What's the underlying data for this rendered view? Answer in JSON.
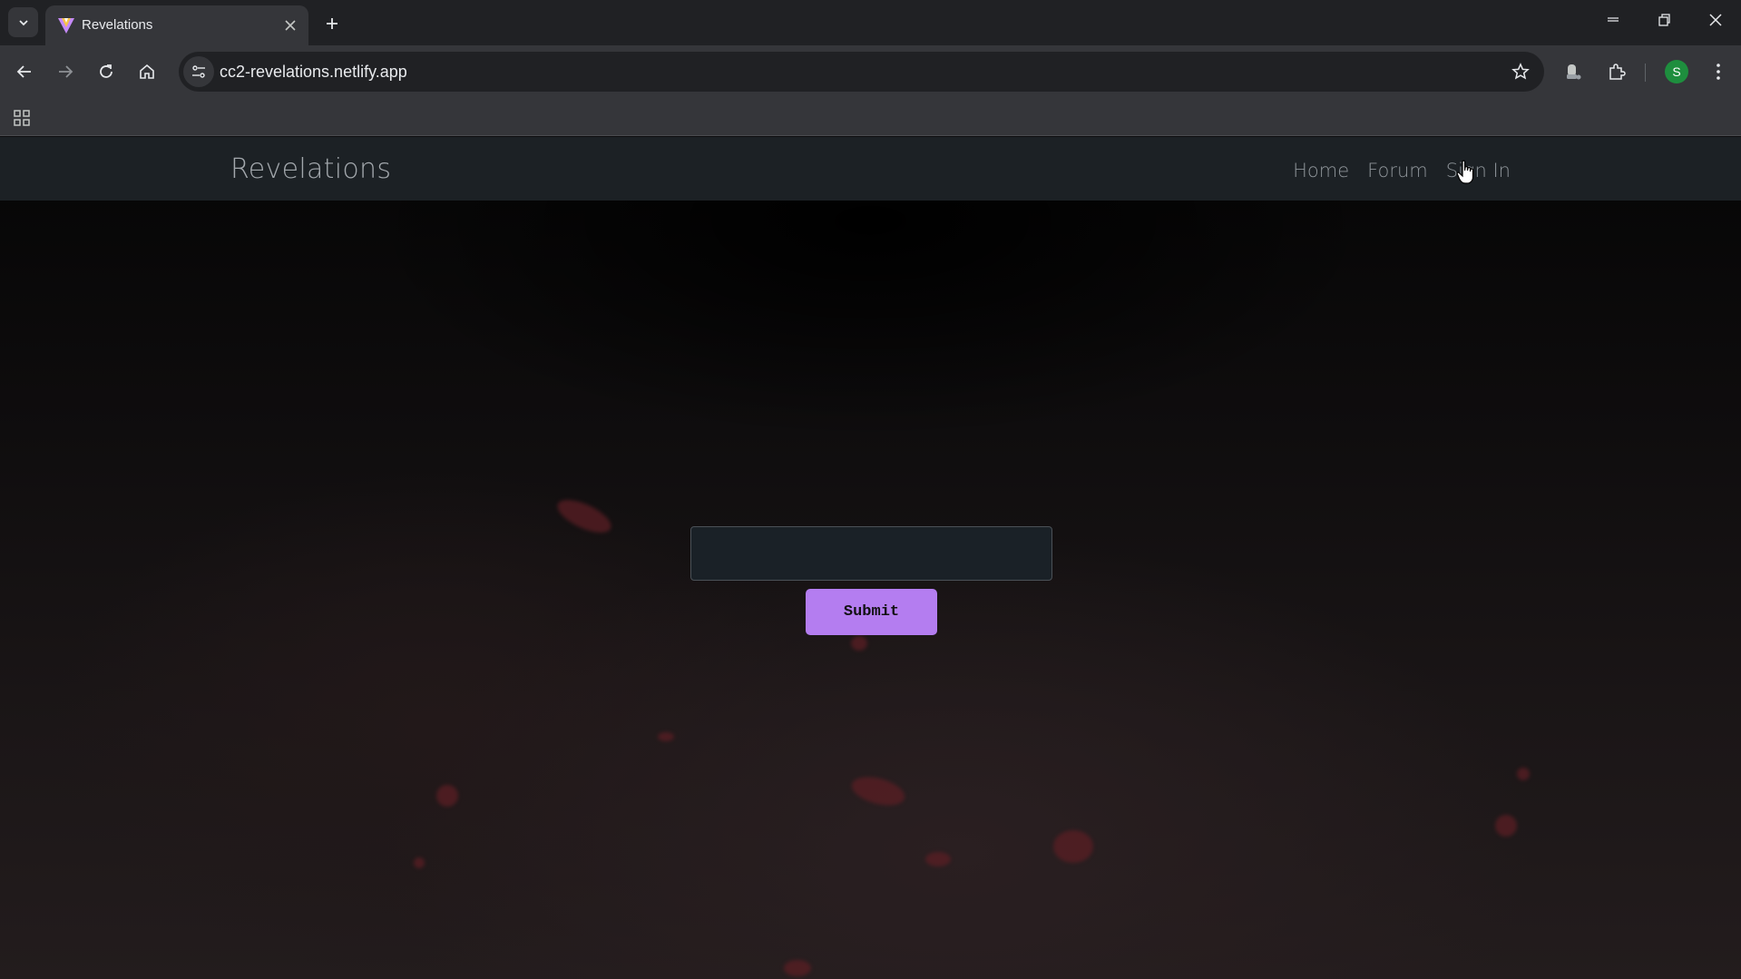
{
  "browser": {
    "tab": {
      "title": "Revelations"
    },
    "omnibox": {
      "url": "cc2-revelations.netlify.app"
    },
    "profile": {
      "initial": "S"
    },
    "icons": {
      "tab_search": "chevron-down-icon",
      "favicon": "revelations-favicon",
      "tab_close": "close-icon",
      "new_tab": "plus-icon",
      "minimize": "minimize-icon",
      "restore": "restore-icon",
      "close_window": "close-icon",
      "back": "back-arrow-icon",
      "forward": "forward-arrow-icon",
      "reload": "reload-icon",
      "home": "home-icon",
      "site_info": "tune-icon",
      "bookmark": "star-icon",
      "extension_1": "extension-badge-icon",
      "extensions": "puzzle-icon",
      "menu": "kebab-menu-icon",
      "apps": "apps-grid-icon"
    }
  },
  "site": {
    "brand": "Revelations",
    "nav": [
      "Home",
      "Forum",
      "Sign In"
    ],
    "form": {
      "input_value": "",
      "submit_label": "Submit"
    }
  },
  "colors": {
    "tabstrip_bg": "#202124",
    "toolbar_bg": "#35363a",
    "site_nav_bg": "#1c2125",
    "submit_bg": "#b47df0",
    "ember": "#5a1e24"
  }
}
